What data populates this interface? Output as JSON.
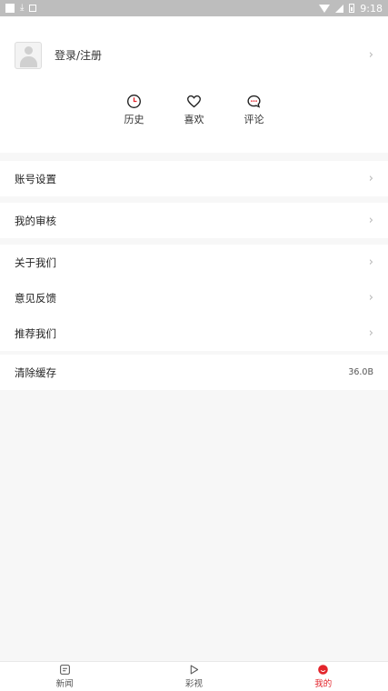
{
  "status_bar": {
    "time": "9:18"
  },
  "profile": {
    "label": "登录/注册"
  },
  "quick_actions": [
    {
      "label": "历史",
      "icon": "clock-icon"
    },
    {
      "label": "喜欢",
      "icon": "heart-icon"
    },
    {
      "label": "评论",
      "icon": "comment-icon"
    }
  ],
  "menu": {
    "account_settings": "账号设置",
    "my_review": "我的审核",
    "about_us": "关于我们",
    "feedback": "意见反馈",
    "recommend_us": "推荐我们",
    "clear_cache": "清除缓存",
    "cache_size": "36.0B"
  },
  "tabs": [
    {
      "label": "新闻",
      "icon": "news-icon"
    },
    {
      "label": "彩视",
      "icon": "play-icon"
    },
    {
      "label": "我的",
      "icon": "profile-icon",
      "active": true
    }
  ],
  "colors": {
    "accent": "#e3242b"
  }
}
